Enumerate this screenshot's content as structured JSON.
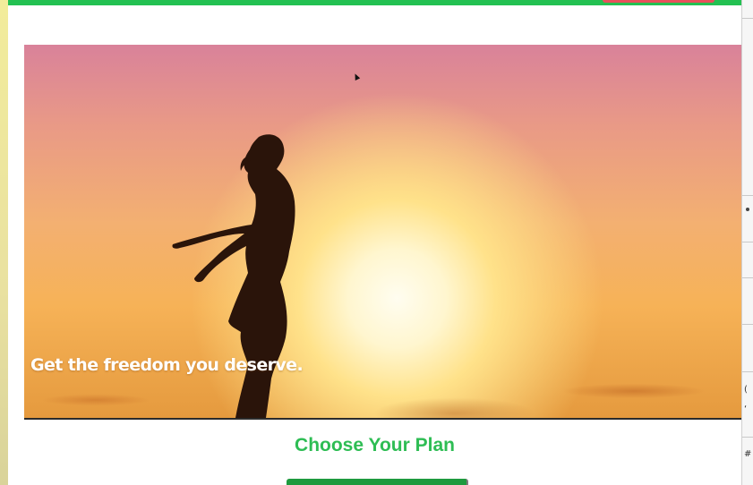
{
  "hero": {
    "caption": "Get the freedom you deserve."
  },
  "plans": {
    "title": "Choose Your Plan"
  },
  "colors": {
    "brand_green": "#23c152",
    "title_green": "#2ebd54",
    "button_green": "#1e9a3e",
    "accent_red": "#e8505b"
  }
}
